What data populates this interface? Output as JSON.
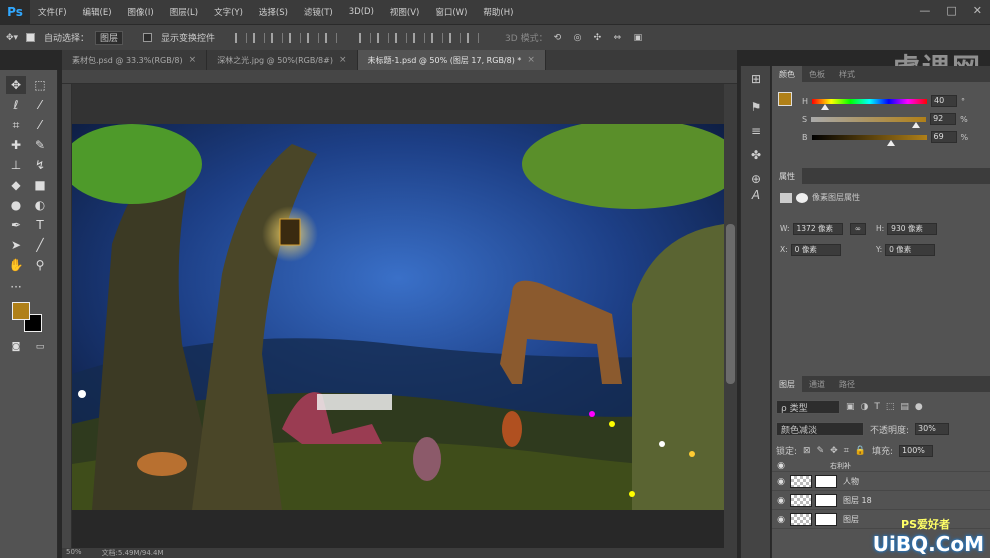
{
  "app": {
    "logo": "Ps"
  },
  "menu": [
    "文件(F)",
    "编辑(E)",
    "图像(I)",
    "图层(L)",
    "文字(Y)",
    "选择(S)",
    "滤镜(T)",
    "3D(D)",
    "视图(V)",
    "窗口(W)",
    "帮助(H)"
  ],
  "window_controls": [
    "—",
    "□",
    "✕"
  ],
  "options": {
    "auto_select_label": "自动选择：",
    "auto_select_value": "图层",
    "show_transform_label": "显示变换控件",
    "mode_3d_label": "3D 模式："
  },
  "watermark": "虎课网",
  "tabs": [
    {
      "label": "素材包.psd @ 33.3%(RGB/8)",
      "active": false
    },
    {
      "label": "深林之光.jpg @ 50%(RGB/8#)",
      "active": false
    },
    {
      "label": "未标题-1.psd @ 50% (图层 17, RGB/8) *",
      "active": true
    }
  ],
  "status": {
    "zoom": "50%",
    "doc": "文档:5.49M/94.4M"
  },
  "color_panel": {
    "tabs": [
      "颜色",
      "色板",
      "样式"
    ],
    "h_label": "H",
    "h_value": "40",
    "h_unit": "°",
    "s_label": "S",
    "s_value": "92",
    "s_unit": "%",
    "b_label": "B",
    "b_value": "69",
    "b_unit": "%",
    "foreground": "#b08018"
  },
  "properties_panel": {
    "title": "属性",
    "subtitle": "像素图层属性",
    "w_label": "W:",
    "w_value": "1372 像素",
    "h_label": "H:",
    "h_value": "930 像素",
    "x_label": "X:",
    "x_value": "0 像素",
    "y_label": "Y:",
    "y_value": "0 像素"
  },
  "layers_panel": {
    "tabs": [
      "图层",
      "通道",
      "路径"
    ],
    "filter_label": "ρ 类型",
    "blend_mode": "颜色减淡",
    "opacity_label": "不透明度:",
    "opacity_value": "30%",
    "lock_label": "锁定:",
    "fill_label": "填充:",
    "fill_value": "100%",
    "layers": [
      {
        "name": "右利补"
      },
      {
        "name": "人物"
      },
      {
        "name": "图层 18"
      },
      {
        "name": "图层"
      }
    ]
  },
  "site_watermark": "UiBQ.CoM",
  "site_watermark_top": "PS爱好者"
}
